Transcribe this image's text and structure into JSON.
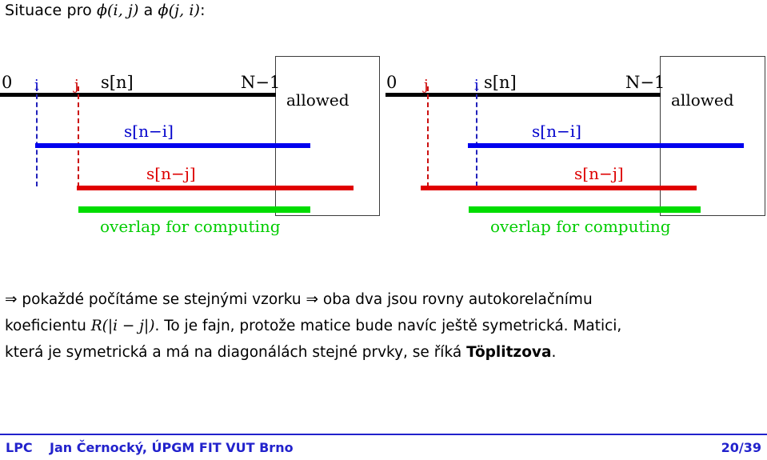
{
  "title": {
    "prefix": "Situace pro ",
    "math1": "ϕ(i, j)",
    "mid": " a ",
    "math2": "ϕ(j, i)",
    "suffix": ":"
  },
  "figure": {
    "left_diagram": {
      "axis_start_label": "0",
      "axis_end_label": "N−1",
      "signal_label": "s[n]",
      "first_index_label": "i",
      "first_index_color": "#0000cc",
      "second_index_label": "j",
      "second_index_color": "#cc0000",
      "allowed_label": "allowed",
      "blue_bar_label": "s[n−i]",
      "red_bar_label": "s[n−j]",
      "green_bar_label": "overlap for computing"
    },
    "right_diagram": {
      "axis_start_label": "0",
      "axis_end_label": "N−1",
      "signal_label": "s[n]",
      "first_index_label": "j",
      "first_index_color": "#cc0000",
      "second_index_label": "i",
      "second_index_color": "#0000cc",
      "allowed_label": "allowed",
      "blue_bar_label": "s[n−i]",
      "red_bar_label": "s[n−j]",
      "green_bar_label": "overlap for computing"
    },
    "colors": {
      "signal": "#000000",
      "blue": "#0000ee",
      "red": "#e00000",
      "green": "#00dd00",
      "box_border": "#3c3c3c"
    }
  },
  "body": {
    "line1_arrow": "⇒",
    "line1_a": " pokaždé počítáme se stejnými vzorku ",
    "line1_arrow2": "⇒",
    "line1_b": " oba dva jsou rovny autokorelačnímu",
    "line2_a": "koeficientu ",
    "line2_math": "R(|i − j|)",
    "line2_b": ". To je fajn, protože matice bude navíc ještě symetrická. Matici,",
    "line3_a": "která je symetrická a má na diagonálách stejné prvky, se říká ",
    "line3_bold": "Töplitzova",
    "line3_b": "."
  },
  "footer": {
    "course": "LPC",
    "author": "Jan Černocký, ÚPGM FIT VUT Brno",
    "page": "20/39",
    "color": "#2222cc"
  }
}
